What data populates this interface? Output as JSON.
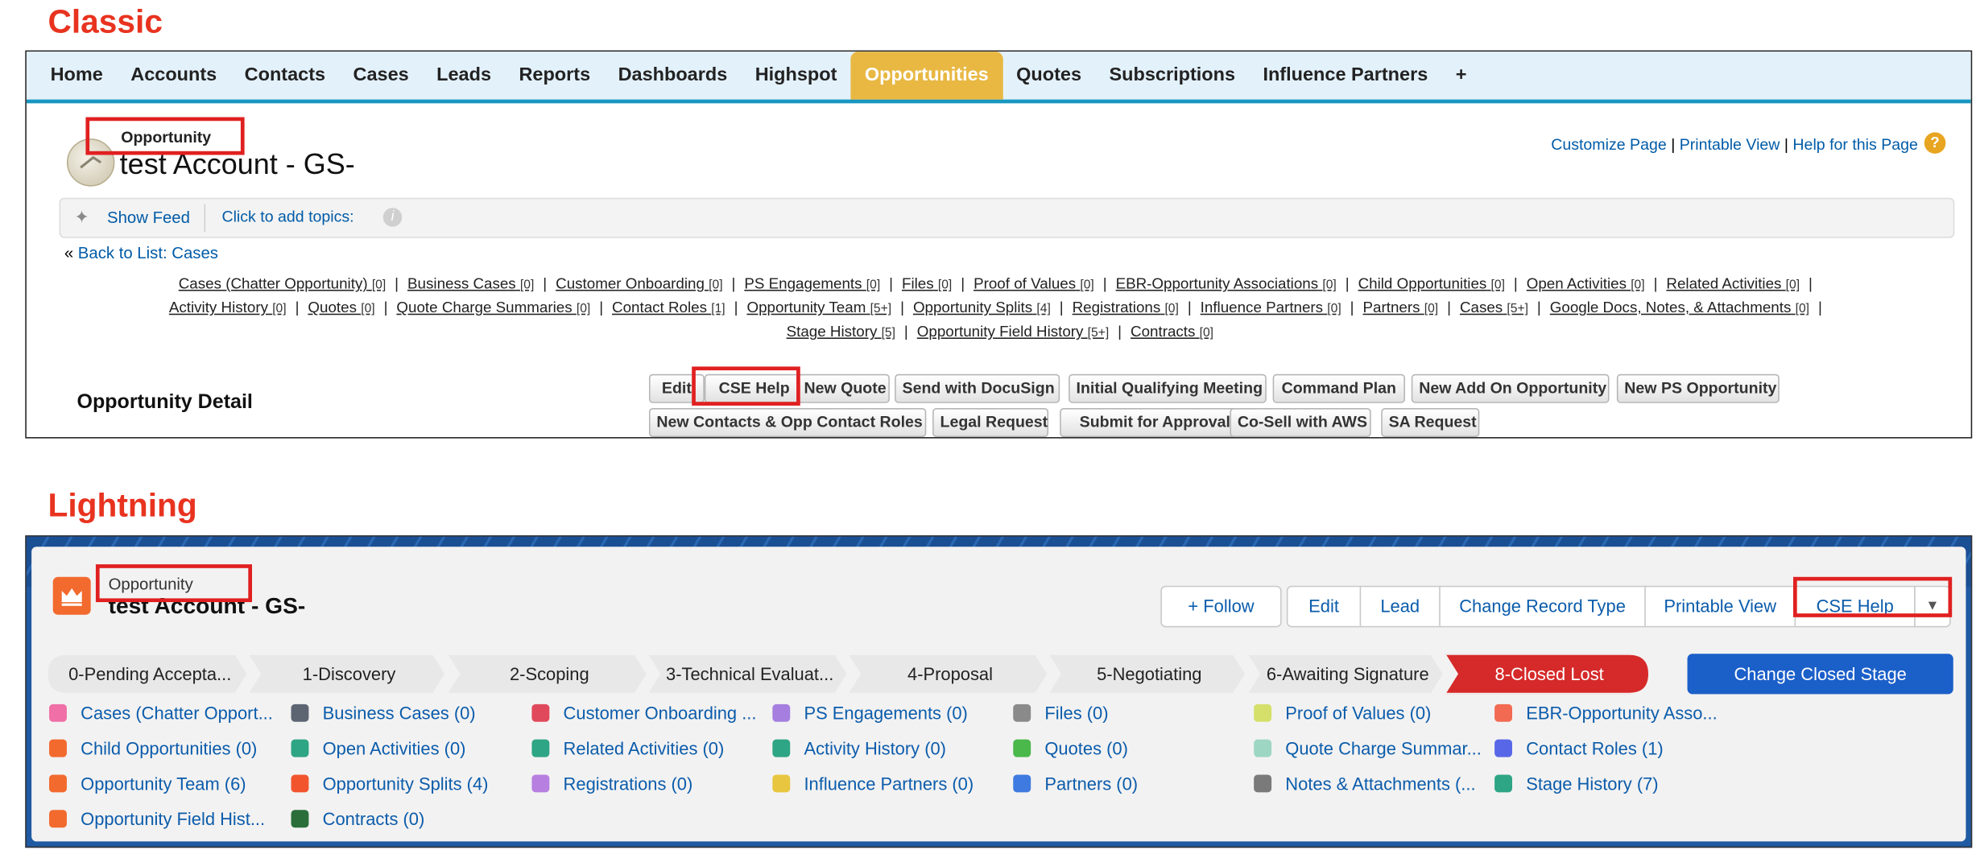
{
  "labels": {
    "classic": "Classic",
    "lightning": "Lightning"
  },
  "classic": {
    "tabs": [
      "Home",
      "Accounts",
      "Contacts",
      "Cases",
      "Leads",
      "Reports",
      "Dashboards",
      "Highspot",
      "Opportunities",
      "Quotes",
      "Subscriptions",
      "Influence Partners",
      "+"
    ],
    "active_tab": "Opportunities",
    "record_type": "Opportunity",
    "record_name": "test Account - GS-",
    "top_links": [
      "Customize Page",
      "Printable View",
      "Help for this Page"
    ],
    "top_link_sep": "|",
    "show_feed": "Show Feed",
    "add_topics": "Click to add topics:",
    "back_prefix": "«",
    "back_link": "Back to List: Cases",
    "related_lines": [
      [
        [
          "Cases (Chatter Opportunity)",
          "[0]"
        ],
        [
          "Business Cases",
          "[0]"
        ],
        [
          "Customer Onboarding",
          "[0]"
        ],
        [
          "PS Engagements",
          "[0]"
        ],
        [
          "Files",
          "[0]"
        ],
        [
          "Proof of Values",
          "[0]"
        ],
        [
          "EBR-Opportunity Associations",
          "[0]"
        ],
        [
          "Child Opportunities",
          "[0]"
        ],
        [
          "Open Activities",
          "[0]"
        ],
        [
          "Related Activities",
          "[0]"
        ]
      ],
      [
        [
          "Activity History",
          "[0]"
        ],
        [
          "Quotes",
          "[0]"
        ],
        [
          "Quote Charge Summaries",
          "[0]"
        ],
        [
          "Contact Roles",
          "[1]"
        ],
        [
          "Opportunity Team",
          "[5+]"
        ],
        [
          "Opportunity Splits",
          "[4]"
        ],
        [
          "Registrations",
          "[0]"
        ],
        [
          "Influence Partners",
          "[0]"
        ],
        [
          "Partners",
          "[0]"
        ],
        [
          "Cases",
          "[5+]"
        ],
        [
          "Google Docs, Notes, & Attachments",
          "[0]"
        ]
      ],
      [
        [
          "Stage History",
          "[5]"
        ],
        [
          "Opportunity Field History",
          "[5+]"
        ],
        [
          "Contracts",
          "[0]"
        ]
      ]
    ],
    "related_sep": "|",
    "detail_title": "Opportunity Detail",
    "buttons_row1": [
      "Edit",
      "CSE Help",
      "New Quote",
      "Send with DocuSign",
      "Initial Qualifying Meeting",
      "Command Plan",
      "New Add On Opportunity",
      "New PS Opportunity"
    ],
    "buttons_row2": [
      "New Contacts & Opp Contact Roles",
      "Legal Request",
      "Submit for Approval",
      "Co-Sell with AWS",
      "SA Request"
    ]
  },
  "lightning": {
    "record_type": "Opportunity",
    "record_name": "test Account - GS-",
    "follow": "+ Follow",
    "actions": [
      "Edit",
      "Lead",
      "Change Record Type",
      "Printable View",
      "CSE Help"
    ],
    "path": [
      "0-Pending Accepta...",
      "1-Discovery",
      "2-Scoping",
      "3-Technical Evaluat...",
      "4-Proposal",
      "5-Negotiating",
      "6-Awaiting Signature",
      "8-Closed Lost"
    ],
    "current_stage": "8-Closed Lost",
    "change_stage": "Change Closed Stage",
    "related": [
      {
        "label": "Cases (Chatter Opport...",
        "color": "#f06fa7"
      },
      {
        "label": "Business Cases (0)",
        "color": "#5d6573"
      },
      {
        "label": "Customer Onboarding ...",
        "color": "#e0495b"
      },
      {
        "label": "PS Engagements (0)",
        "color": "#a57ee0"
      },
      {
        "label": "Files (0)",
        "color": "#8a8a8a"
      },
      {
        "label": "Proof of Values (0)",
        "color": "#d4e06a"
      },
      {
        "label": "EBR-Opportunity Asso...",
        "color": "#f26a52"
      },
      {
        "label": "Child Opportunities (0)",
        "color": "#f26a2e"
      },
      {
        "label": "Open Activities (0)",
        "color": "#2ea584"
      },
      {
        "label": "Related Activities (0)",
        "color": "#2ea584"
      },
      {
        "label": "Activity History (0)",
        "color": "#2ea584"
      },
      {
        "label": "Quotes (0)",
        "color": "#4bb84b"
      },
      {
        "label": "Quote Charge Summar...",
        "color": "#9ed6c4"
      },
      {
        "label": "Contact Roles (1)",
        "color": "#5867e8"
      },
      {
        "label": "Opportunity Team (6)",
        "color": "#f26a2e"
      },
      {
        "label": "Opportunity Splits (4)",
        "color": "#f2552e"
      },
      {
        "label": "Registrations (0)",
        "color": "#b77fe0"
      },
      {
        "label": "Influence Partners (0)",
        "color": "#e8c640"
      },
      {
        "label": "Partners (0)",
        "color": "#3e7ae0"
      },
      {
        "label": "Notes & Attachments (...",
        "color": "#7a7a7a"
      },
      {
        "label": "Stage History (7)",
        "color": "#2ea584"
      },
      {
        "label": "Opportunity Field Hist...",
        "color": "#f26a2e"
      },
      {
        "label": "Contracts (0)",
        "color": "#2b6e3a"
      }
    ]
  }
}
